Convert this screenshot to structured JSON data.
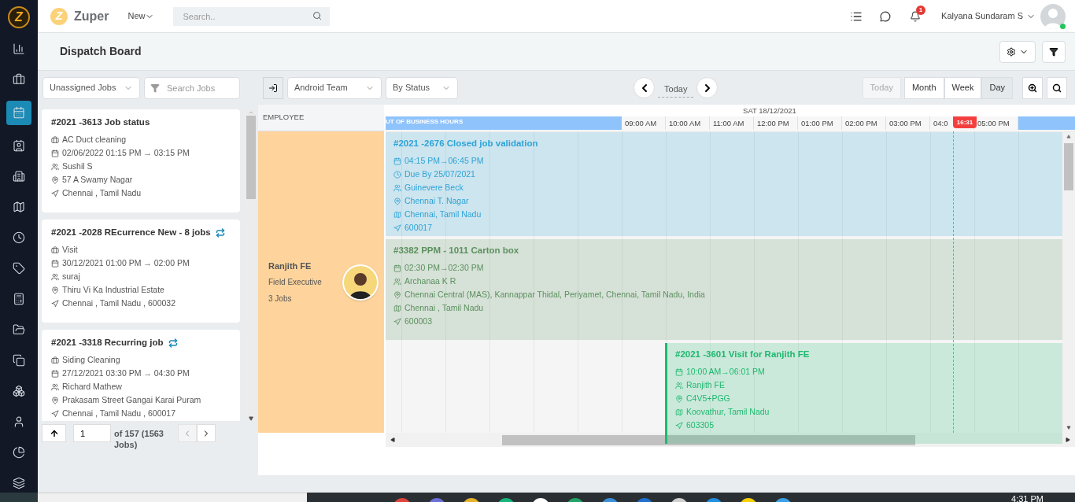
{
  "sidebar": {
    "logo": "Z",
    "items": [
      {
        "selected": false
      },
      {
        "selected": false
      },
      {
        "selected": true
      },
      {
        "selected": false
      },
      {
        "selected": false
      },
      {
        "selected": false
      },
      {
        "selected": false
      },
      {
        "selected": false
      },
      {
        "selected": false
      },
      {
        "selected": false
      },
      {
        "selected": false
      },
      {
        "selected": false
      },
      {
        "selected": false
      },
      {
        "selected": false
      },
      {
        "selected": false
      }
    ]
  },
  "header": {
    "logo_mark": "Z",
    "brand": "Zuper",
    "new_menu": "New",
    "search": {
      "placeholder": "Search.."
    },
    "notifications": "1",
    "user": "Kalyana Sundaram S",
    "online": true
  },
  "page_title": "Dispatch Board",
  "toolbar": {
    "job_filter": "Unassigned Jobs",
    "job_search": {
      "placeholder": "Search Jobs"
    },
    "team": "Android Team",
    "group_by": "By Status",
    "date_label": "Today",
    "views": [
      {
        "label": "Today",
        "disabled": true,
        "selected": false
      },
      {
        "label": "Month",
        "disabled": false,
        "selected": false
      },
      {
        "label": "Week",
        "disabled": false,
        "selected": false
      },
      {
        "label": "Day",
        "disabled": false,
        "selected": true
      }
    ]
  },
  "job_cards": [
    {
      "title": "#2021 -3613 Job status",
      "recurring": false,
      "lines": [
        {
          "kind": "service",
          "text": "AC Duct cleaning"
        },
        {
          "kind": "schedule",
          "text": "02/06/2022 01:15 PM → 03:15 PM"
        },
        {
          "kind": "customer",
          "text": "Sushil S"
        },
        {
          "kind": "address",
          "text": "57 A Swamy Nagar"
        },
        {
          "kind": "location",
          "text": "Chennai , Tamil Nadu"
        }
      ]
    },
    {
      "title": "#2021 -2028 REcurrence New - 8 jobs",
      "recurring": true,
      "lines": [
        {
          "kind": "service",
          "text": "Visit"
        },
        {
          "kind": "schedule",
          "text": "30/12/2021 01:00 PM → 02:00 PM"
        },
        {
          "kind": "customer",
          "text": "suraj"
        },
        {
          "kind": "address",
          "text": "Thiru Vi Ka Industrial Estate"
        },
        {
          "kind": "location",
          "text": "Chennai , Tamil Nadu , 600032"
        }
      ]
    },
    {
      "title": "#2021 -3318 Recurring job",
      "recurring": true,
      "lines": [
        {
          "kind": "service",
          "text": "Siding Cleaning"
        },
        {
          "kind": "schedule",
          "text": "27/12/2021 03:30 PM → 04:30 PM"
        },
        {
          "kind": "customer",
          "text": "Richard Mathew"
        },
        {
          "kind": "address",
          "text": "Prakasam Street Gangai Karai Puram"
        },
        {
          "kind": "location",
          "text": "Chennai , Tamil Nadu , 600017"
        }
      ]
    }
  ],
  "pagination": {
    "page": "1",
    "summary": "of 157 (1563 Jobs)"
  },
  "employee_header": "EMPLOYEE",
  "employee": {
    "name": "Ranjith FE",
    "role": "Field Executive",
    "jobs": "3 Jobs"
  },
  "timeline": {
    "date": "SAT 18/12/2021",
    "off_hours": "UT OF BUSINESS HOURS",
    "hours": [
      "09:00 AM",
      "10:00 AM",
      "11:00 AM",
      "12:00 PM",
      "01:00 PM",
      "02:00 PM",
      "03:00 PM",
      "04:0",
      "05:00 PM"
    ],
    "now": "16:31"
  },
  "events": [
    {
      "title": "#2021 -2676 Closed job validation",
      "color": "#2ea3d6",
      "starts_before_view": true,
      "lines": [
        {
          "kind": "schedule",
          "text": "04:15 PM→06:45 PM"
        },
        {
          "kind": "due",
          "text": "Due By 25/07/2021"
        },
        {
          "kind": "customer",
          "text": "Guinevere Beck"
        },
        {
          "kind": "address",
          "text": "Chennai T. Nagar"
        },
        {
          "kind": "city",
          "text": "Chennai, Tamil Nadu"
        },
        {
          "kind": "location",
          "text": "600017"
        }
      ]
    },
    {
      "title": "#3382 PPM - 1011 Carton box",
      "color": "#5b915f",
      "starts_before_view": true,
      "lines": [
        {
          "kind": "schedule",
          "text": "02:30 PM→02:30 PM"
        },
        {
          "kind": "customer",
          "text": "Archanaa K R"
        },
        {
          "kind": "address",
          "text": "Chennai Central (MAS), Kannappar Thidal, Periyamet, Chennai, Tamil Nadu, India"
        },
        {
          "kind": "city",
          "text": "Chennai , Tamil Nadu"
        },
        {
          "kind": "location",
          "text": "600003"
        }
      ]
    },
    {
      "title": "#2021 -3601 Visit for Ranjith FE",
      "color": "#1fb870",
      "starts_before_view": false,
      "lines": [
        {
          "kind": "schedule",
          "text": "10:00 AM→06:01 PM"
        },
        {
          "kind": "customer",
          "text": "Ranjith FE"
        },
        {
          "kind": "address",
          "text": "C4V5+PGG"
        },
        {
          "kind": "city",
          "text": "Koovathur, Tamil Nadu"
        },
        {
          "kind": "location",
          "text": "603305"
        }
      ]
    }
  ],
  "taskbar": {
    "clock": "4:31 PM"
  }
}
